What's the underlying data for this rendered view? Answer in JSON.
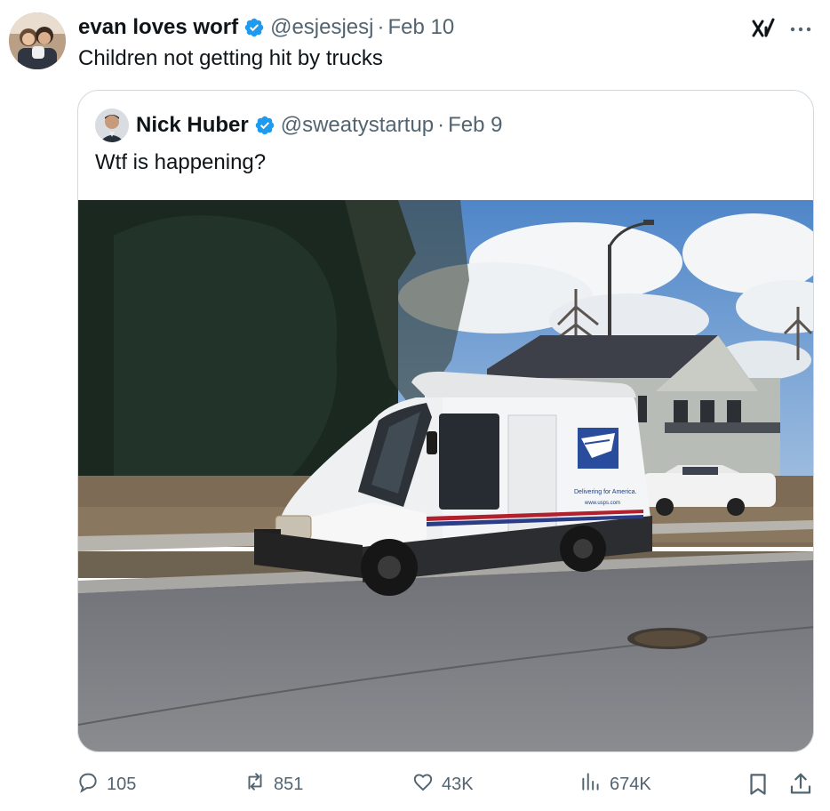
{
  "tweet": {
    "author_name": "evan loves worf",
    "handle": "@esjesjesj",
    "separator": "·",
    "date": "Feb 10",
    "text": "Children not getting hit by trucks"
  },
  "quoted": {
    "author_name": "Nick Huber",
    "handle": "@sweatystartup",
    "separator": "·",
    "date": "Feb 9",
    "text": "Wtf is happening?",
    "media": {
      "truck_side_text_1": "Delivering for America.",
      "truck_side_text_2": "www.usps.com"
    }
  },
  "actions": {
    "replies": "105",
    "reposts": "851",
    "likes": "43K",
    "views": "674K"
  },
  "colors": {
    "text": "#0f1419",
    "secondary": "#536471",
    "verified": "#1d9bf0",
    "border": "#cfd9de"
  },
  "icons": [
    "verified-badge-icon",
    "grok-icon",
    "more-icon",
    "reply-icon",
    "repost-icon",
    "like-icon",
    "views-icon",
    "bookmark-icon",
    "share-icon"
  ]
}
